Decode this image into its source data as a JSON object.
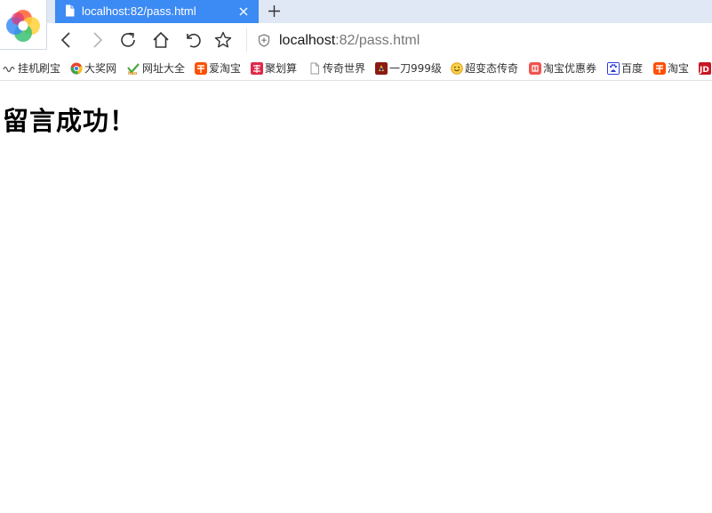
{
  "browser": {
    "tab": {
      "title": "localhost:82/pass.html"
    },
    "address": {
      "host": "localhost",
      "rest": ":82/pass.html"
    }
  },
  "bookmarks": [
    {
      "label": "挂机刷宝",
      "icon": "wave-icon",
      "color": "#555555"
    },
    {
      "label": "大奖网",
      "icon": "chrome-ball-icon",
      "color": "#e8442f"
    },
    {
      "label": "网址大全",
      "icon": "hao-icon",
      "color": "#4aa83a"
    },
    {
      "label": "爱淘宝",
      "icon": "taobao-icon",
      "color": "#ff5000"
    },
    {
      "label": "聚划算",
      "icon": "juhuasuan-icon",
      "color": "#e02849"
    },
    {
      "label": "传奇世界",
      "icon": "page-icon",
      "color": "#9a9a9a"
    },
    {
      "label": "一刀999级",
      "icon": "game-icon",
      "color": "#8a1b12"
    },
    {
      "label": "超变态传奇",
      "icon": "smiley-icon",
      "color": "#f0a020"
    },
    {
      "label": "淘宝优惠券",
      "icon": "coupon-icon",
      "color": "#f0544f"
    },
    {
      "label": "百度",
      "icon": "baidu-paw-icon",
      "color": "#2d3bd8"
    },
    {
      "label": "淘宝",
      "icon": "taobao-icon",
      "color": "#ff5000"
    },
    {
      "label": "",
      "icon": "jd-icon",
      "color": "#c81623"
    }
  ],
  "content": {
    "heading": "留言成功！"
  },
  "colors": {
    "tab_active": "#3c8af3",
    "tabstrip": "#dfe8f4"
  }
}
